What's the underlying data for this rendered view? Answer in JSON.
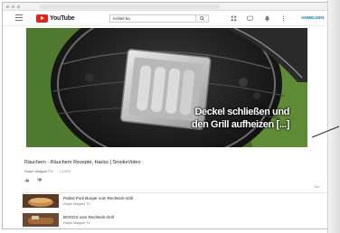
{
  "header": {
    "logo_text": "YouTube",
    "search_value": "Kohlel ba",
    "signin_label": "ANMELDEN"
  },
  "player": {
    "caption_line1": "Deckel schließen und",
    "caption_line2": "den Grill aufheizen [...]"
  },
  "video": {
    "title": "Räuchern - Räuchern Rezepte, Hacks | SmokeVideo",
    "channel": "Ralph Malgavi TV",
    "subs": "13.890",
    "views": "3rz"
  },
  "related": [
    {
      "title": "Pulled Pork Burger vom Rechteck-Grill",
      "channel": "Ralph Malgavi TV"
    },
    {
      "title": "BOGGS vom Rechteck-Grill",
      "channel": "Ralph Malgavi TV"
    }
  ],
  "icons": {
    "search": "search-icon",
    "apps": "apps-icon",
    "messages": "messages-icon",
    "notifications": "bell-icon",
    "more": "more-icon"
  },
  "colors": {
    "brand_red": "#e62117",
    "link_blue": "#167ac6"
  }
}
